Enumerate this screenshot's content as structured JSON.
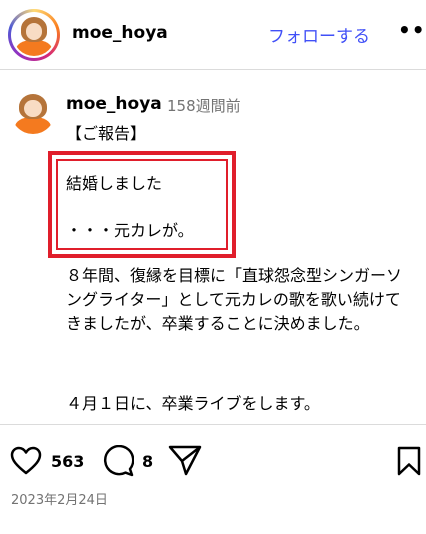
{
  "header": {
    "username": "moe_hoya",
    "follow_label": "フォローする",
    "more_icon": "more-horizontal-icon",
    "more_glyph": "•••"
  },
  "caption": {
    "username": "moe_hoya",
    "time_ago": "158週間前",
    "report": "【ご報告】",
    "highlight_line1": "結婚しました",
    "highlight_line2": "・・・元カレが。",
    "highlight_color": "#e01e2b",
    "body": "８年間、復縁を目標に「直球怨念型シンガーソングライター」として元カレの歌を歌い続けてきましたが、卒業することに決めました。",
    "body2": "４月１日に、卒業ライブをします。"
  },
  "actions": {
    "like_icon": "heart-icon",
    "like_count": "563",
    "comment_icon": "comment-icon",
    "comment_count": "8",
    "share_icon": "share-icon",
    "save_icon": "bookmark-icon"
  },
  "post_date": "2023年2月24日",
  "colors": {
    "link": "#4150f7",
    "muted": "#737373",
    "shirt": "#f47a1f"
  }
}
